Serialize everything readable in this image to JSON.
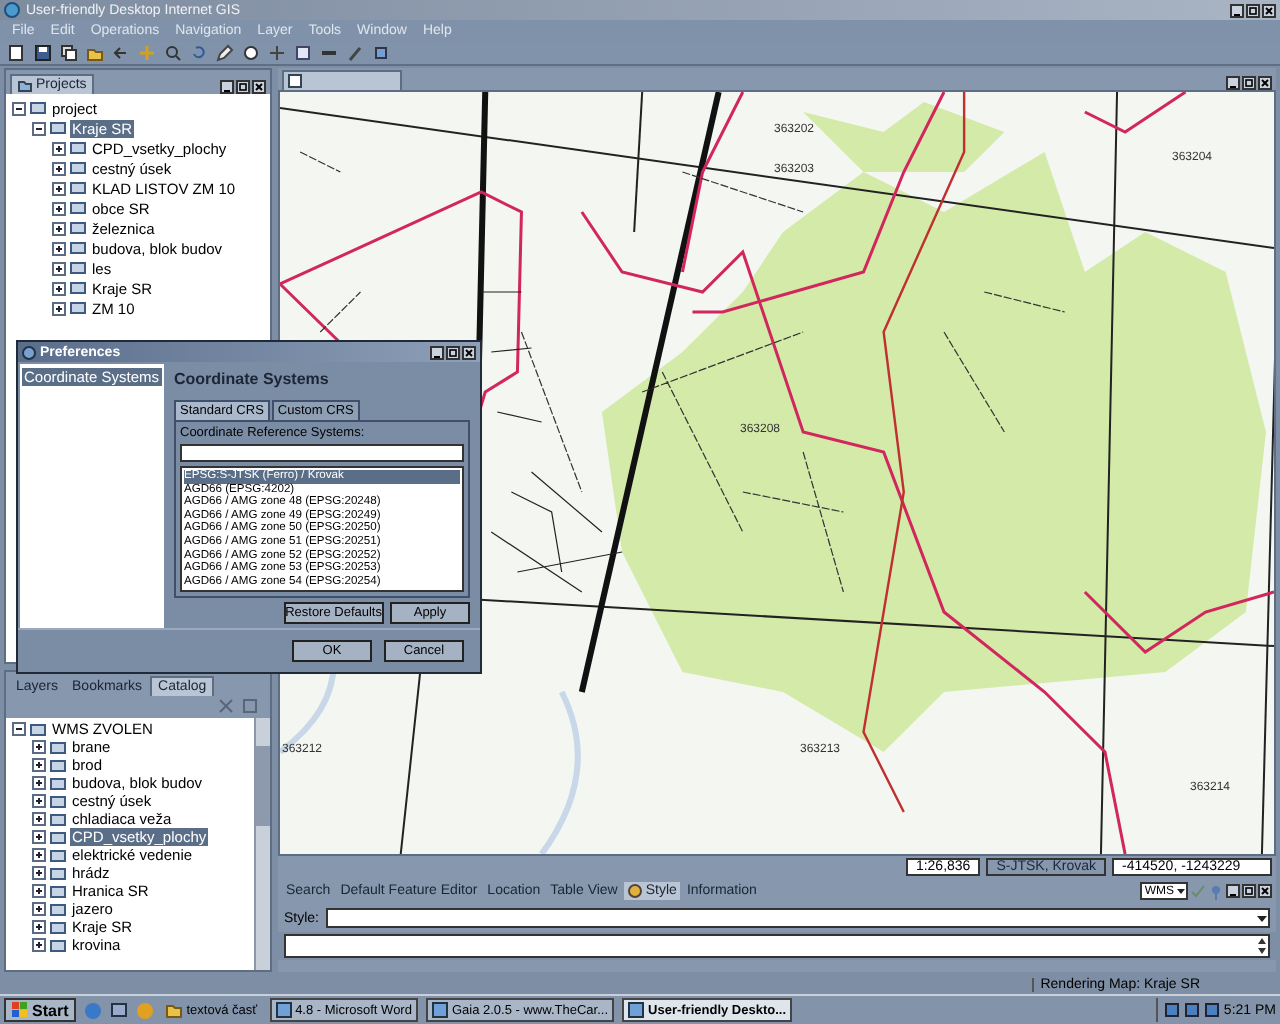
{
  "window": {
    "title": "User-friendly Desktop Internet GIS"
  },
  "menu": [
    "File",
    "Edit",
    "Operations",
    "Navigation",
    "Layer",
    "Tools",
    "Window",
    "Help"
  ],
  "projects_panel": {
    "title": "Projects",
    "tree": [
      {
        "label": "project",
        "expanded": true,
        "selected": false,
        "children": [
          {
            "label": "Kraje SR",
            "expanded": true,
            "selected": true,
            "children": [
              {
                "label": "CPD_vsetky_plochy",
                "expanded": false,
                "selected": false
              },
              {
                "label": "cestný úsek",
                "expanded": false,
                "selected": false
              },
              {
                "label": "KLAD LISTOV ZM 10",
                "expanded": false,
                "selected": false
              },
              {
                "label": "obce SR",
                "expanded": false,
                "selected": false
              },
              {
                "label": "železnica",
                "expanded": false,
                "selected": false
              },
              {
                "label": "budova, blok budov",
                "expanded": false,
                "selected": false
              },
              {
                "label": "les",
                "expanded": false,
                "selected": false
              },
              {
                "label": "Kraje SR",
                "expanded": false,
                "selected": false
              },
              {
                "label": "ZM 10",
                "expanded": false,
                "selected": false
              }
            ]
          }
        ]
      }
    ]
  },
  "catalog_panel": {
    "tabs": [
      {
        "label": "Layers",
        "selected": false
      },
      {
        "label": "Bookmarks",
        "selected": false
      },
      {
        "label": "Catalog",
        "selected": true
      }
    ],
    "tree": [
      {
        "label": "WMS ZVOLEN",
        "expanded": true,
        "selected": false,
        "children": [
          {
            "label": "brane",
            "expanded": false,
            "selected": false
          },
          {
            "label": "brod",
            "expanded": false,
            "selected": false
          },
          {
            "label": "budova, blok budov",
            "expanded": false,
            "selected": false
          },
          {
            "label": "cestný úsek",
            "expanded": false,
            "selected": false
          },
          {
            "label": "chladiaca veža",
            "expanded": false,
            "selected": false
          },
          {
            "label": "CPD_vsetky_plochy",
            "expanded": false,
            "selected": true
          },
          {
            "label": "elektrické vedenie",
            "expanded": false,
            "selected": false
          },
          {
            "label": "hrádz",
            "expanded": false,
            "selected": false
          },
          {
            "label": "Hranica SR",
            "expanded": false,
            "selected": false
          },
          {
            "label": "jazero",
            "expanded": false,
            "selected": false
          },
          {
            "label": "Kraje SR",
            "expanded": false,
            "selected": false
          },
          {
            "label": "krovina",
            "expanded": false,
            "selected": false
          }
        ]
      }
    ]
  },
  "map": {
    "sheet_labels": [
      "363202",
      "363203",
      "363204",
      "363208",
      "363212",
      "363213",
      "363214"
    ],
    "scale": "1:26,836",
    "crs": "S-JTSK, Krovak",
    "coordinates": "-414520, -1243229"
  },
  "bottom_panel": {
    "tabs": [
      {
        "label": "Search",
        "selected": false
      },
      {
        "label": "Default Feature Editor",
        "selected": false
      },
      {
        "label": "Location",
        "selected": false
      },
      {
        "label": "Table View",
        "selected": false
      },
      {
        "label": "Style",
        "selected": true
      },
      {
        "label": "Information",
        "selected": false
      }
    ],
    "service": "WMS",
    "style_label": "Style:"
  },
  "status_bar": "Rendering Map: Kraje SR",
  "preferences": {
    "title": "Preferences",
    "tree": [
      {
        "label": "Coordinate Systems",
        "selected": true
      }
    ],
    "heading": "Coordinate Systems",
    "tabs": [
      {
        "label": "Standard CRS",
        "selected": true
      },
      {
        "label": "Custom CRS",
        "selected": false
      }
    ],
    "list_label": "Coordinate Reference Systems:",
    "list": [
      {
        "label": "EPSG:S-JTSK (Ferro) / Krovak",
        "selected": true
      },
      {
        "label": "AGD66 (EPSG:4202)",
        "selected": false
      },
      {
        "label": "AGD66 / AMG zone 48 (EPSG:20248)",
        "selected": false
      },
      {
        "label": "AGD66 / AMG zone 49 (EPSG:20249)",
        "selected": false
      },
      {
        "label": "AGD66 / AMG zone 50 (EPSG:20250)",
        "selected": false
      },
      {
        "label": "AGD66 / AMG zone 51 (EPSG:20251)",
        "selected": false
      },
      {
        "label": "AGD66 / AMG zone 52 (EPSG:20252)",
        "selected": false
      },
      {
        "label": "AGD66 / AMG zone 53 (EPSG:20253)",
        "selected": false
      },
      {
        "label": "AGD66 / AMG zone 54 (EPSG:20254)",
        "selected": false
      }
    ],
    "buttons": [
      "Restore Defaults",
      "Apply",
      "OK",
      "Cancel"
    ]
  },
  "taskbar": {
    "start": "Start",
    "tasks": [
      {
        "label": "textová časť",
        "selected": false
      },
      {
        "label": "4.8 - Microsoft Word",
        "selected": false
      },
      {
        "label": "Gaia 2.0.5 - www.TheCar...",
        "selected": false
      },
      {
        "label": "User-friendly Deskto...",
        "selected": true
      }
    ],
    "clock": "5:21 PM"
  }
}
